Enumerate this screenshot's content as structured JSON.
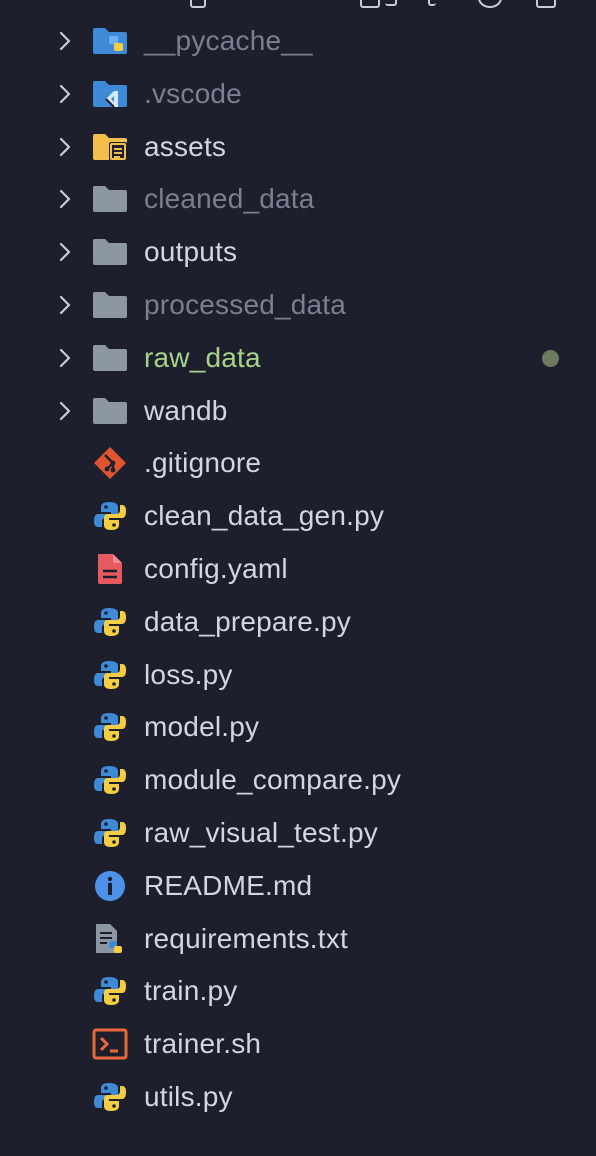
{
  "explorer": {
    "items": [
      {
        "label": "__pycache__",
        "type": "folder",
        "icon": "python-folder-icon",
        "dim": true,
        "expandable": true
      },
      {
        "label": ".vscode",
        "type": "folder",
        "icon": "vscode-folder-icon",
        "dim": true,
        "expandable": true
      },
      {
        "label": "assets",
        "type": "folder",
        "icon": "assets-folder-icon",
        "dim": false,
        "expandable": true
      },
      {
        "label": "cleaned_data",
        "type": "folder",
        "icon": "folder-icon",
        "dim": true,
        "expandable": true
      },
      {
        "label": "outputs",
        "type": "folder",
        "icon": "folder-icon",
        "dim": false,
        "expandable": true
      },
      {
        "label": "processed_data",
        "type": "folder",
        "icon": "folder-icon",
        "dim": true,
        "expandable": true
      },
      {
        "label": "raw_data",
        "type": "folder",
        "icon": "folder-icon",
        "dim": false,
        "expandable": true,
        "modified": true
      },
      {
        "label": "wandb",
        "type": "folder",
        "icon": "folder-icon",
        "dim": false,
        "expandable": true
      },
      {
        "label": ".gitignore",
        "type": "file",
        "icon": "git-icon"
      },
      {
        "label": "clean_data_gen.py",
        "type": "file",
        "icon": "python-icon"
      },
      {
        "label": "config.yaml",
        "type": "file",
        "icon": "yaml-icon"
      },
      {
        "label": "data_prepare.py",
        "type": "file",
        "icon": "python-icon"
      },
      {
        "label": "loss.py",
        "type": "file",
        "icon": "python-icon"
      },
      {
        "label": "model.py",
        "type": "file",
        "icon": "python-icon"
      },
      {
        "label": "module_compare.py",
        "type": "file",
        "icon": "python-icon"
      },
      {
        "label": "raw_visual_test.py",
        "type": "file",
        "icon": "python-icon"
      },
      {
        "label": "README.md",
        "type": "file",
        "icon": "info-icon"
      },
      {
        "label": "requirements.txt",
        "type": "file",
        "icon": "requirements-icon"
      },
      {
        "label": "train.py",
        "type": "file",
        "icon": "python-icon"
      },
      {
        "label": "trainer.sh",
        "type": "file",
        "icon": "terminal-icon"
      },
      {
        "label": "utils.py",
        "type": "file",
        "icon": "python-icon"
      }
    ]
  },
  "colors": {
    "background": "#1e1f2c",
    "text": "#d3d6e2",
    "dim_text": "#7b7f91",
    "modified_text": "#a6d38a",
    "folder": "#8d96a3",
    "python_blue": "#3f8ad6",
    "python_yellow": "#f4cd45",
    "git": "#e0552f",
    "yaml": "#e45a5f",
    "info": "#4d92e8",
    "terminal": "#e8683d",
    "modified_dot": "#6e7a5e"
  }
}
